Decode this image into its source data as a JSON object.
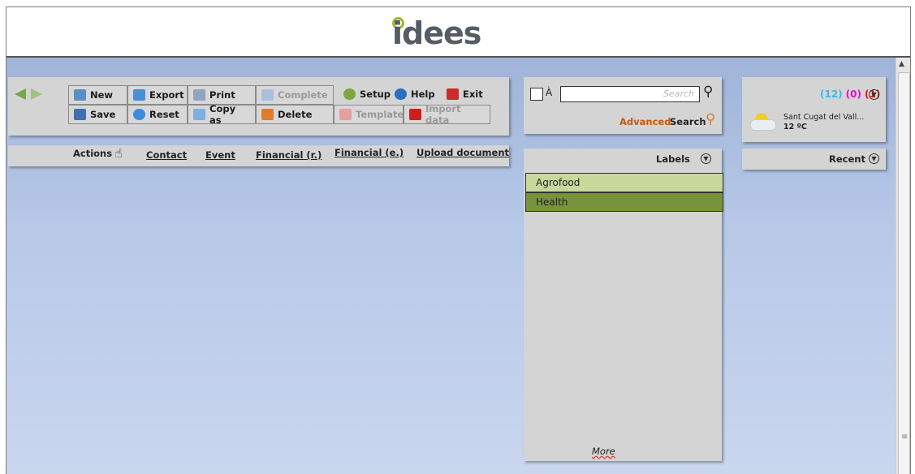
{
  "logo": {
    "text": "idees"
  },
  "toolbar": {
    "new": "New",
    "export": "Export",
    "print": "Print",
    "complete": "Complete",
    "setup": "Setup",
    "help": "Help",
    "exit": "Exit",
    "save": "Save",
    "reset": "Reset",
    "copy_as": "Copy as",
    "delete": "Delete",
    "template": "Template",
    "import_data": "Import data"
  },
  "actions_bar": {
    "actions": "Actions",
    "links": [
      "Contact",
      "Event",
      "Financial (r.)",
      "Financial (e.)",
      "Upload document"
    ]
  },
  "search": {
    "checkbox_label": "À",
    "placeholder": "Search",
    "advanced": "Advanced",
    "search": "Search"
  },
  "labels": {
    "header": "Labels",
    "items": [
      {
        "text": "Agrofood",
        "color": "#c6d99a"
      },
      {
        "text": "Health",
        "color": "#77933c"
      }
    ],
    "more": "More"
  },
  "notifications": {
    "c1": "(12)",
    "c2": "(0)",
    "c3": "(1)",
    "color1": "#33bbee",
    "color2": "#dd11cc",
    "color3": "#ee1111"
  },
  "weather": {
    "location": "Sant Cugat del Vall...",
    "temperature": "12 ºC"
  },
  "recent": {
    "header": "Recent"
  }
}
